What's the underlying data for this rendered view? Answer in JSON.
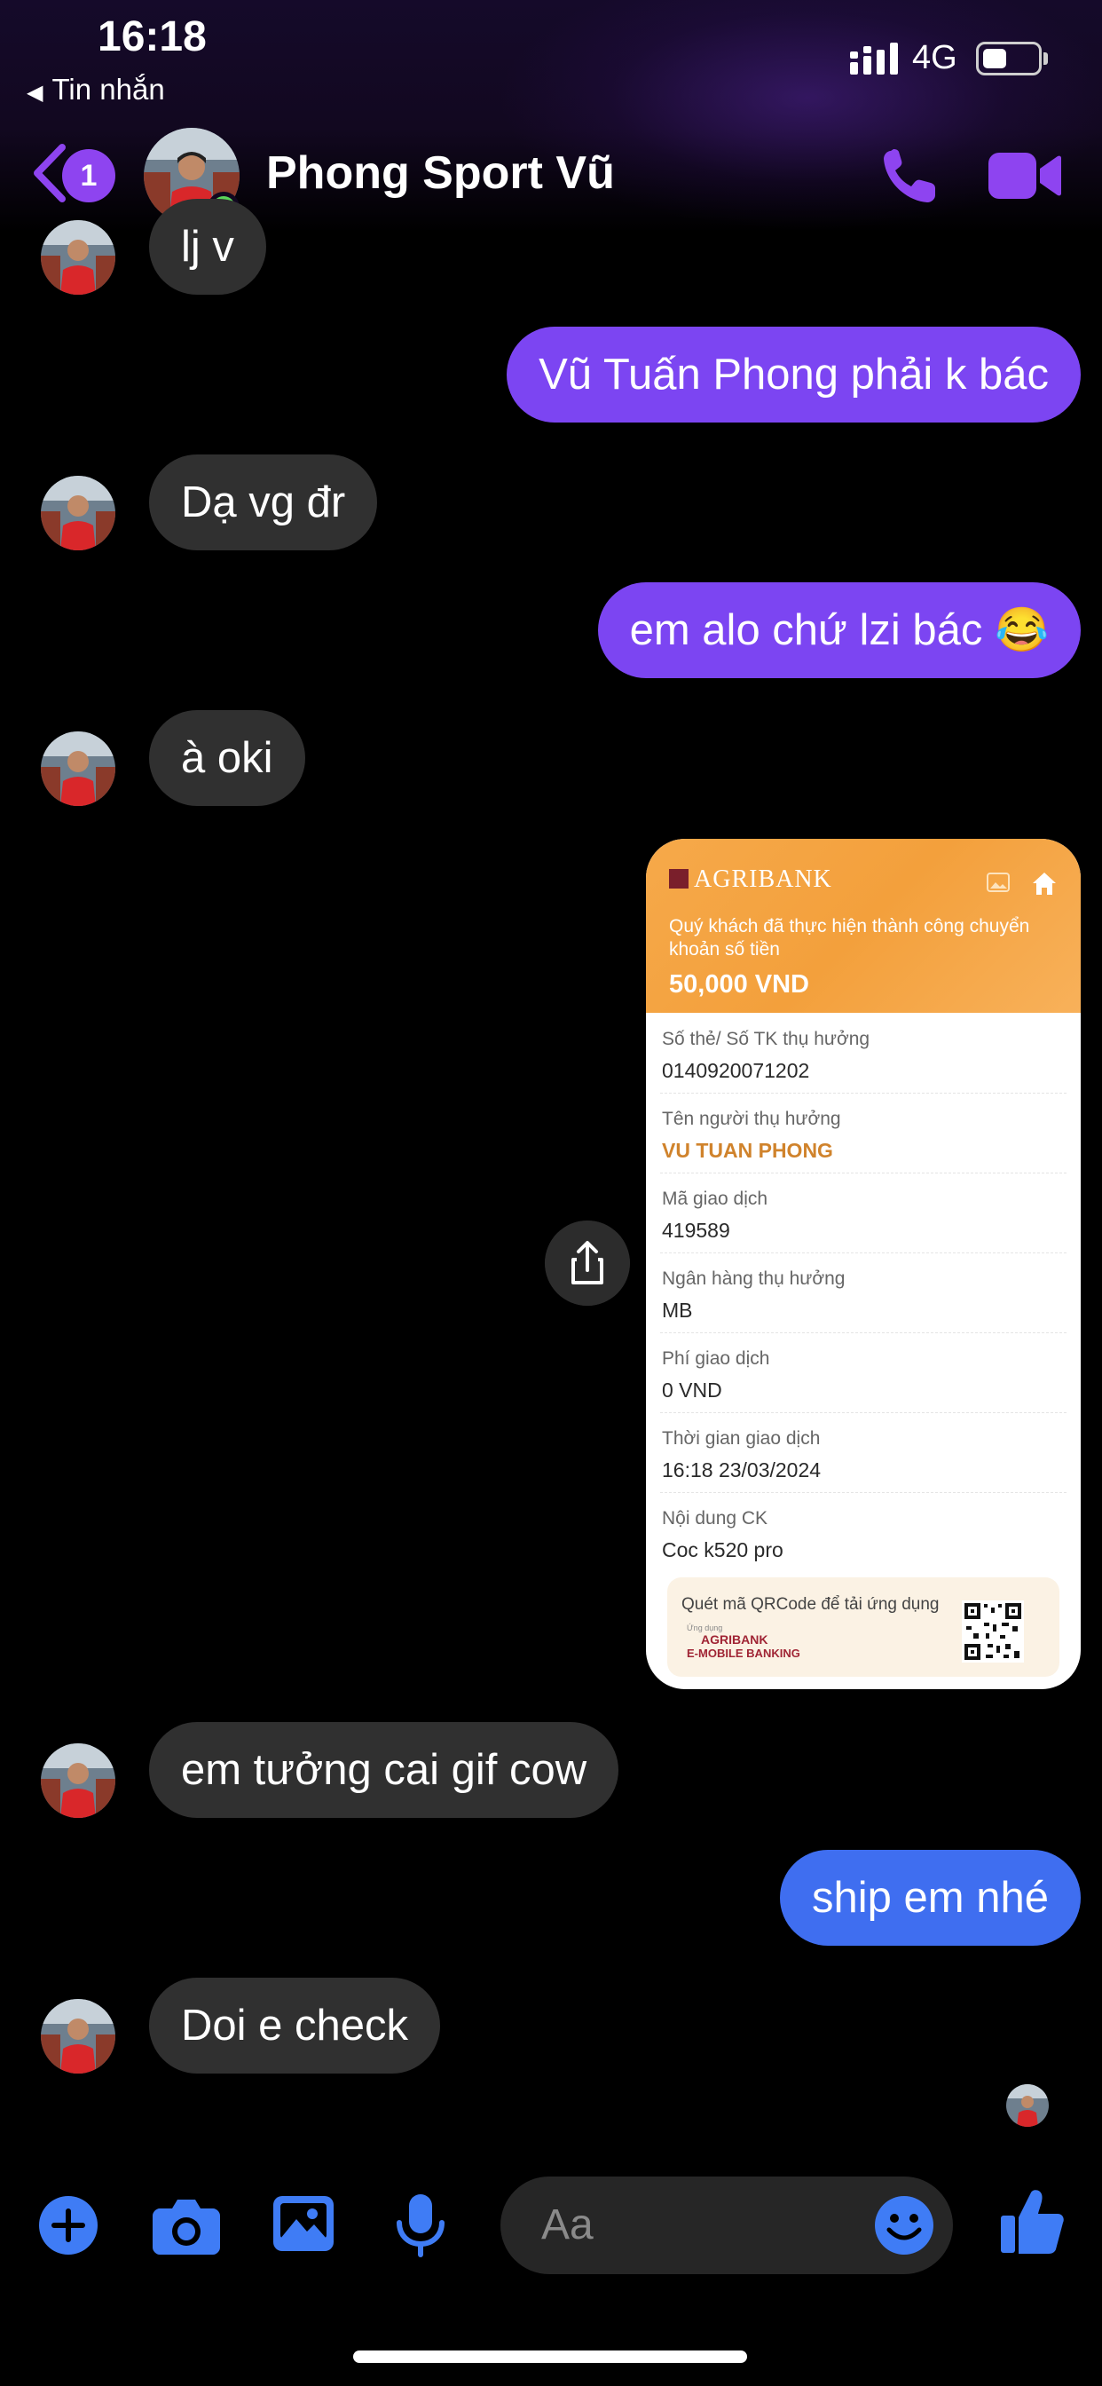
{
  "status_bar": {
    "time": "16:18",
    "back_app_label": "Tin nhắn",
    "network": "4G",
    "battery_level": 0.35
  },
  "header": {
    "unread_count": "1",
    "contact_name": "Phong Sport Vũ",
    "online": true,
    "accent_color": "#8e44f0"
  },
  "messages": [
    {
      "side": "incoming",
      "text": "lj v"
    },
    {
      "side": "outgoing",
      "text": "Vũ Tuấn Phong phải k bác"
    },
    {
      "side": "incoming",
      "text": "Dạ vg đr"
    },
    {
      "side": "outgoing",
      "text": "em alo chứ lzi bác 😂"
    },
    {
      "side": "incoming",
      "text": "à oki"
    },
    {
      "side": "incoming",
      "text": "em tưởng cai gif cow"
    },
    {
      "side": "outgoing",
      "text": "ship em nhé"
    },
    {
      "side": "incoming",
      "text": "Doi e check"
    }
  ],
  "receipt": {
    "bank": "AGRIBANK",
    "intro": "Quý khách đã thực hiện thành công chuyển khoản số tiền",
    "amount": "50,000 VND",
    "rows": [
      {
        "label": "Số thẻ/ Số TK thụ hưởng",
        "value": "0140920071202"
      },
      {
        "label": "Tên người thụ hưởng",
        "value": "VU TUAN PHONG"
      },
      {
        "label": "Mã giao dịch",
        "value": "419589"
      },
      {
        "label": "Ngân hàng thụ hưởng",
        "value": "MB"
      },
      {
        "label": "Phí giao dịch",
        "value": "0 VND"
      },
      {
        "label": "Thời gian giao dịch",
        "value": "16:18 23/03/2024"
      },
      {
        "label": "Nội dung CK",
        "value": "Coc k520 pro"
      }
    ],
    "qr_text": "Quét mã QRCode để tải ứng dụng",
    "app_mini": "Ứng dụng",
    "app_name": "AGRIBANK",
    "app_sub": "E-MOBILE BANKING"
  },
  "composer": {
    "placeholder": "Aa"
  },
  "colors": {
    "outgoing_purple": "#7c45f2",
    "outgoing_blue": "#3f6ef0",
    "incoming": "#303030",
    "icon_blue": "#3f7cf5"
  },
  "icons": [
    "back-chevron",
    "phone",
    "video-camera",
    "share",
    "plus",
    "camera",
    "image",
    "microphone",
    "emoji",
    "thumbs-up"
  ]
}
